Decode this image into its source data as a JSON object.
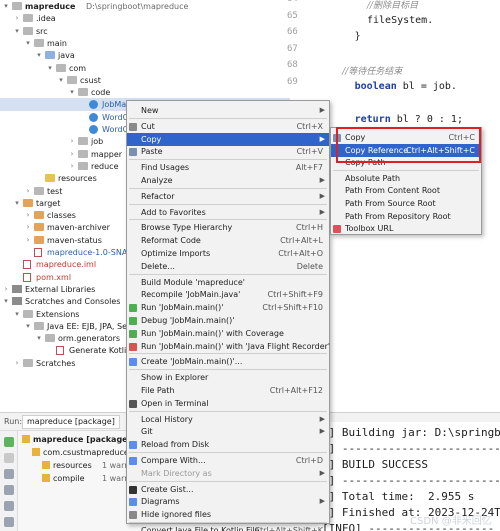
{
  "tree": {
    "items": [
      {
        "indent": 0,
        "chev": "▾",
        "icon": "folder-gray",
        "label": "mapreduce",
        "path": "D:\\springboot\\mapreduce",
        "style": "bold"
      },
      {
        "indent": 1,
        "chev": "›",
        "icon": "folder-gray",
        "label": ".idea"
      },
      {
        "indent": 1,
        "chev": "▾",
        "icon": "folder-gray",
        "label": "src"
      },
      {
        "indent": 2,
        "chev": "▾",
        "icon": "folder-gray",
        "label": "main"
      },
      {
        "indent": 3,
        "chev": "▾",
        "icon": "folder-blue",
        "label": "java"
      },
      {
        "indent": 4,
        "chev": "▾",
        "icon": "folder-gray",
        "label": "com"
      },
      {
        "indent": 5,
        "chev": "▾",
        "icon": "folder-gray",
        "label": "csust"
      },
      {
        "indent": 6,
        "chev": "▾",
        "icon": "folder-gray",
        "label": "code"
      },
      {
        "indent": 7,
        "chev": "",
        "icon": "class",
        "label": "JobMai",
        "style": "blue",
        "selected": true
      },
      {
        "indent": 7,
        "chev": "",
        "icon": "class",
        "label": "WordC",
        "style": "blue"
      },
      {
        "indent": 7,
        "chev": "",
        "icon": "class",
        "label": "WordC",
        "style": "blue"
      },
      {
        "indent": 6,
        "chev": "›",
        "icon": "folder-gray",
        "label": "job"
      },
      {
        "indent": 6,
        "chev": "›",
        "icon": "folder-gray",
        "label": "mapper"
      },
      {
        "indent": 6,
        "chev": "›",
        "icon": "folder-gray",
        "label": "reduce"
      },
      {
        "indent": 3,
        "chev": "",
        "icon": "folder-yellow",
        "label": "resources"
      },
      {
        "indent": 2,
        "chev": "›",
        "icon": "folder-gray",
        "label": "test"
      },
      {
        "indent": 1,
        "chev": "▾",
        "icon": "folder-orange",
        "label": "target"
      },
      {
        "indent": 2,
        "chev": "›",
        "icon": "folder-orange",
        "label": "classes"
      },
      {
        "indent": 2,
        "chev": "›",
        "icon": "folder-orange",
        "label": "maven-archiver"
      },
      {
        "indent": 2,
        "chev": "›",
        "icon": "folder-orange",
        "label": "maven-status"
      },
      {
        "indent": 2,
        "chev": "",
        "icon": "file",
        "label": "mapreduce-1.0-SNAPS",
        "style": "blue"
      },
      {
        "indent": 1,
        "chev": "",
        "icon": "file",
        "label": "mapreduce.iml",
        "style": "red"
      },
      {
        "indent": 1,
        "chev": "",
        "icon": "file",
        "label": "pom.xml",
        "style": "red"
      },
      {
        "indent": 0,
        "chev": "›",
        "icon": "lib",
        "label": "External Libraries"
      },
      {
        "indent": 0,
        "chev": "▾",
        "icon": "lib",
        "label": "Scratches and Consoles"
      },
      {
        "indent": 1,
        "chev": "▾",
        "icon": "folder-gray",
        "label": "Extensions"
      },
      {
        "indent": 2,
        "chev": "▾",
        "icon": "folder-gray",
        "label": "Java EE: EJB, JPA, Servl"
      },
      {
        "indent": 3,
        "chev": "▾",
        "icon": "folder-gray",
        "label": "orm.generators"
      },
      {
        "indent": 4,
        "chev": "",
        "icon": "file",
        "label": "Generate Kotlin"
      },
      {
        "indent": 1,
        "chev": "›",
        "icon": "folder-gray",
        "label": "Scratches"
      }
    ]
  },
  "editor": {
    "line_numbers": [
      "64",
      "65",
      "66",
      "67",
      "68",
      "69"
    ],
    "lines": [
      {
        "text": "//删除目标目",
        "kind": "cmt",
        "indent": 10
      },
      {
        "text": "fileSystem.",
        "kind": "code",
        "indent": 10
      },
      {
        "text": "}",
        "kind": "code",
        "indent": 8
      },
      {
        "text": "",
        "kind": "code",
        "indent": 0
      },
      {
        "text": "//等待任务结束",
        "kind": "cmt",
        "indent": 6
      },
      {
        "text": "boolean bl = job.",
        "kind": "code",
        "indent": 8,
        "kw": "boolean"
      },
      {
        "text": "",
        "kind": "code",
        "indent": 0
      },
      {
        "text": "return bl ? 0 : 1;",
        "kind": "code",
        "indent": 8,
        "kw": "return"
      },
      {
        "text": "",
        "kind": "code",
        "indent": 0
      },
      {
        "text": "n(",
        "kind": "code",
        "indent": 15
      },
      {
        "text": "i",
        "kind": "code",
        "indent": 16
      },
      {
        "text": "int run = ToolRunner",
        "kind": "code",
        "indent": 6,
        "kw": "int"
      },
      {
        "text": "System.exit(run);",
        "kind": "code",
        "indent": 6
      },
      {
        "text": "",
        "kind": "code",
        "indent": 0
      },
      {
        "text": "}",
        "kind": "code",
        "indent": 2
      }
    ]
  },
  "context_menu": {
    "items": [
      {
        "label": "New",
        "shortcut": "",
        "submenu": true
      },
      {
        "sep": true
      },
      {
        "label": "Cut",
        "shortcut": "Ctrl+X",
        "icon": "scissors-icon"
      },
      {
        "label": "Copy",
        "shortcut": "",
        "submenu": true,
        "highlighted": true
      },
      {
        "label": "Paste",
        "shortcut": "Ctrl+V",
        "icon": "paste-icon"
      },
      {
        "sep": true
      },
      {
        "label": "Find Usages",
        "shortcut": "Alt+F7"
      },
      {
        "label": "Analyze",
        "shortcut": "",
        "submenu": true
      },
      {
        "sep": true
      },
      {
        "label": "Refactor",
        "shortcut": "",
        "submenu": true
      },
      {
        "sep": true
      },
      {
        "label": "Add to Favorites",
        "shortcut": "",
        "submenu": true
      },
      {
        "sep": true
      },
      {
        "label": "Browse Type Hierarchy",
        "shortcut": "Ctrl+H"
      },
      {
        "label": "Reformat Code",
        "shortcut": "Ctrl+Alt+L"
      },
      {
        "label": "Optimize Imports",
        "shortcut": "Ctrl+Alt+O"
      },
      {
        "label": "Delete...",
        "shortcut": "Delete"
      },
      {
        "sep": true
      },
      {
        "label": "Build Module 'mapreduce'",
        "shortcut": ""
      },
      {
        "label": "Recompile 'JobMain.java'",
        "shortcut": "Ctrl+Shift+F9"
      },
      {
        "label": "Run 'JobMain.main()'",
        "shortcut": "Ctrl+Shift+F10",
        "icon": "run-icon"
      },
      {
        "label": "Debug 'JobMain.main()'",
        "shortcut": "",
        "icon": "debug-icon"
      },
      {
        "label": "Run 'JobMain.main()' with Coverage",
        "shortcut": "",
        "icon": "coverage-icon"
      },
      {
        "label": "Run 'JobMain.main()' with 'Java Flight Recorder'",
        "shortcut": "",
        "icon": "flight-recorder-icon"
      },
      {
        "sep": true
      },
      {
        "label": "Create 'JobMain.main()'...",
        "shortcut": "",
        "icon": "create-icon"
      },
      {
        "sep": true
      },
      {
        "label": "Show in Explorer",
        "shortcut": ""
      },
      {
        "label": "File Path",
        "shortcut": "Ctrl+Alt+F12"
      },
      {
        "label": "Open in Terminal",
        "shortcut": "",
        "icon": "terminal-icon"
      },
      {
        "sep": true
      },
      {
        "label": "Local History",
        "shortcut": "",
        "submenu": true
      },
      {
        "label": "Git",
        "shortcut": "",
        "submenu": true
      },
      {
        "label": "Reload from Disk",
        "shortcut": "",
        "icon": "reload-icon"
      },
      {
        "sep": true
      },
      {
        "label": "Compare With...",
        "shortcut": "Ctrl+D",
        "icon": "compare-icon"
      },
      {
        "label": "Mark Directory as",
        "shortcut": "",
        "submenu": true,
        "disabled": true
      },
      {
        "sep": true
      },
      {
        "label": "Create Gist...",
        "shortcut": "",
        "icon": "github-icon"
      },
      {
        "label": "Diagrams",
        "shortcut": "",
        "submenu": true,
        "icon": "diagrams-icon"
      },
      {
        "label": "Hide ignored files",
        "shortcut": "",
        "icon": "hide-icon"
      },
      {
        "sep": true
      },
      {
        "label": "Convert Java File to Kotlin File",
        "shortcut": "Ctrl+Alt+Shift+K"
      }
    ]
  },
  "submenu": {
    "items": [
      {
        "label": "Copy",
        "shortcut": "Ctrl+C",
        "icon": "copy-icon"
      },
      {
        "label": "Copy Reference",
        "shortcut": "Ctrl+Alt+Shift+C",
        "highlighted": true
      },
      {
        "label": "Copy Path",
        "shortcut": ""
      },
      {
        "sep": true
      },
      {
        "label": "Absolute Path",
        "shortcut": ""
      },
      {
        "label": "Path From Content Root",
        "shortcut": ""
      },
      {
        "label": "Path From Source Root",
        "shortcut": ""
      },
      {
        "label": "Path From Repository Root",
        "shortcut": ""
      },
      {
        "label": "Toolbox URL",
        "shortcut": "",
        "icon": "toolbox-icon"
      }
    ]
  },
  "run_panel": {
    "tab_prefix": "Run:",
    "tab_label": "mapreduce [package]",
    "tree": [
      {
        "label": "mapreduce [package]:",
        "indent": 0,
        "bold": true
      },
      {
        "label": "com.csustmapreduce",
        "indent": 1
      },
      {
        "label": "resources",
        "suffix": "1 warni",
        "indent": 2
      },
      {
        "label": "compile",
        "suffix": "1 warnin",
        "indent": 2
      }
    ]
  },
  "console": {
    "lines": [
      "0] Building jar: D:\\springbo",
      "0] ------------------------",
      "0] BUILD SUCCESS",
      "0] ------------------------",
      "0] Total time:  2.955 s",
      "0] Finished at: 2023-12-24T1",
      "[INFO] -------------------"
    ]
  },
  "watermark": "CSDN @非米回忆"
}
